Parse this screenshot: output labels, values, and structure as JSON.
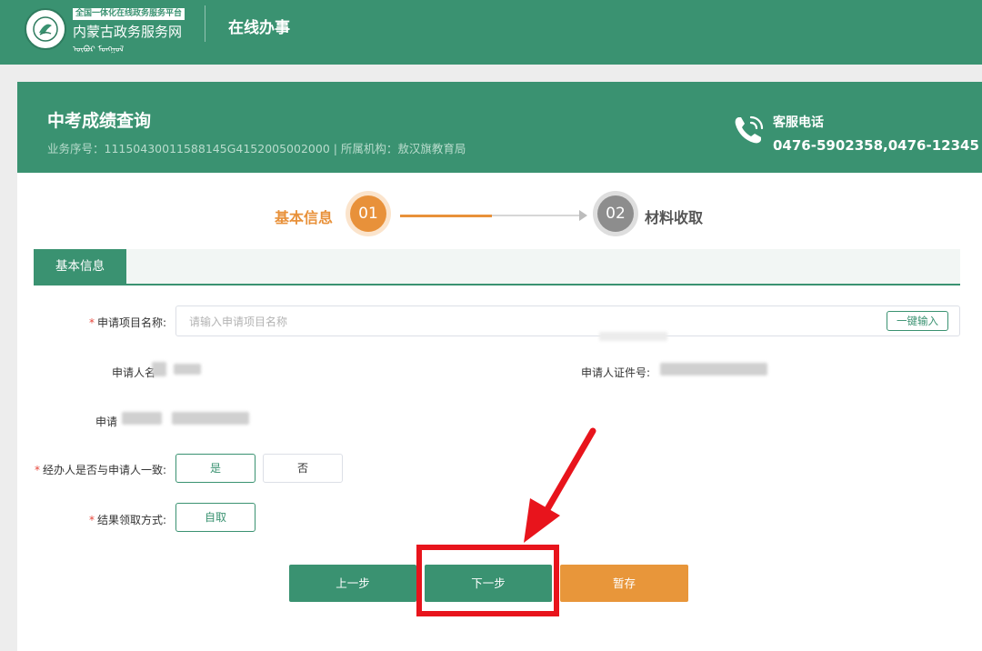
{
  "header": {
    "platform_tag": "全国一体化在线政务服务平台",
    "site_name": "内蒙古政务服务网",
    "site_name_script": "ᠥᠪᠥᠷ ᠮᠣᠩᠭᠣᠯ",
    "section": "在线办事"
  },
  "service": {
    "name": "中考成绩查询",
    "meta": "业务序号：11150430011588145G4152005002000 | 所属机构：敖汉旗教育局",
    "hotline_label": "客服电话",
    "hotline_number": "0476-5902358,0476-12345"
  },
  "steps": [
    {
      "number": "01",
      "label": "基本信息",
      "state": "active"
    },
    {
      "number": "02",
      "label": "材料收取",
      "state": "pending"
    }
  ],
  "tab": {
    "label": "基本信息"
  },
  "form": {
    "project_name": {
      "label": "申请项目名称:",
      "placeholder": "请输入申请项目名称",
      "value": "",
      "quick_fill_label": "一键输入"
    },
    "applicant_name": {
      "label": "申请人名"
    },
    "applicant_id": {
      "label": "申请人证件号:"
    },
    "applicant_other": {
      "label": "申请"
    },
    "agent_same": {
      "label": "经办人是否与申请人一致:",
      "options": [
        "是",
        "否"
      ],
      "selected": "是"
    },
    "delivery": {
      "label": "结果领取方式:",
      "options": [
        "自取"
      ],
      "selected": "自取"
    }
  },
  "actions": {
    "prev_label": "上一步",
    "next_label": "下一步",
    "save_label": "暂存"
  },
  "colors": {
    "brand_green": "#3a9271",
    "accent_orange": "#e8913a",
    "highlight_red": "#e8141c",
    "step_pending_gray": "#8d8d8d"
  }
}
